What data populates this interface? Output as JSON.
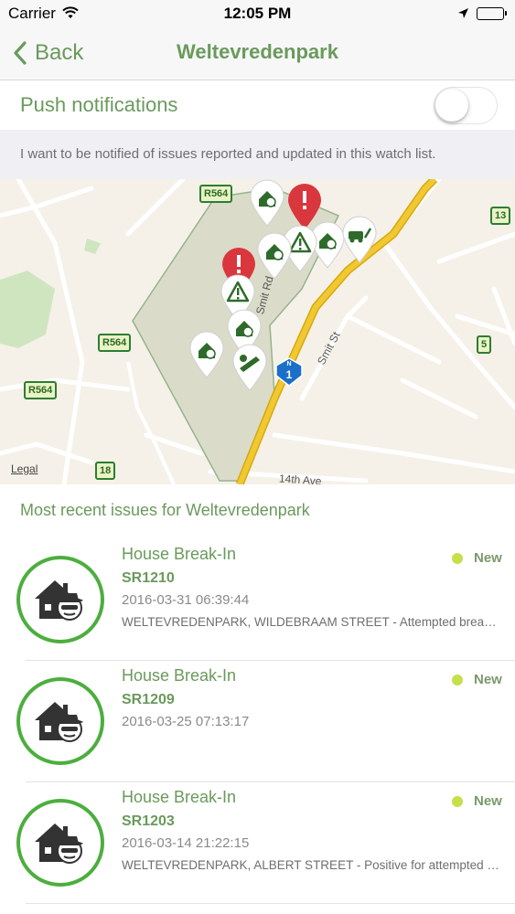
{
  "status_bar": {
    "carrier": "Carrier",
    "time": "12:05 PM"
  },
  "nav": {
    "back_label": "Back",
    "title": "Weltevredenpark"
  },
  "push": {
    "label": "Push notifications",
    "enabled": false
  },
  "info": {
    "text": "I want to be notified of issues reported and updated in this watch list."
  },
  "map": {
    "legal_label": "Legal",
    "street_labels": [
      "Smit St",
      "14th Ave",
      "Smit Rd"
    ],
    "route_shields": [
      "R564",
      "R564",
      "R564",
      "13",
      "5",
      "18"
    ],
    "freeway_shield": {
      "small": "N",
      "number": "1"
    },
    "colors": {
      "land": "#f5f1e8",
      "area": "#d9dbc8",
      "area_border": "#8fb08a",
      "freeway": "#f0c832",
      "road": "#ffffff",
      "park": "#cfe5c0"
    }
  },
  "section": {
    "heading": "Most recent issues for Weltevredenpark"
  },
  "issues": [
    {
      "category": "House Break-In",
      "ref": "SR1210",
      "date": "2016-03-31 06:39:44",
      "description": "WELTEVREDENPARK, WILDEBRAAM STREET - Attempted break-in",
      "status": "New",
      "icon": "house-burglar-icon"
    },
    {
      "category": "House Break-In",
      "ref": "SR1209",
      "date": "2016-03-25 07:13:17",
      "description": "",
      "status": "New",
      "icon": "house-burglar-icon"
    },
    {
      "category": "House Break-In",
      "ref": "SR1203",
      "date": "2016-03-14 21:22:15",
      "description": "WELTEVREDENPARK, ALBERT STREET - Positive for attempted break-in",
      "status": "New",
      "icon": "house-burglar-icon"
    }
  ],
  "colors": {
    "accent": "#6a9a5c",
    "avatar_ring": "#4cae3e",
    "status_new": "#c4e04a",
    "alert_red": "#d9363e"
  }
}
